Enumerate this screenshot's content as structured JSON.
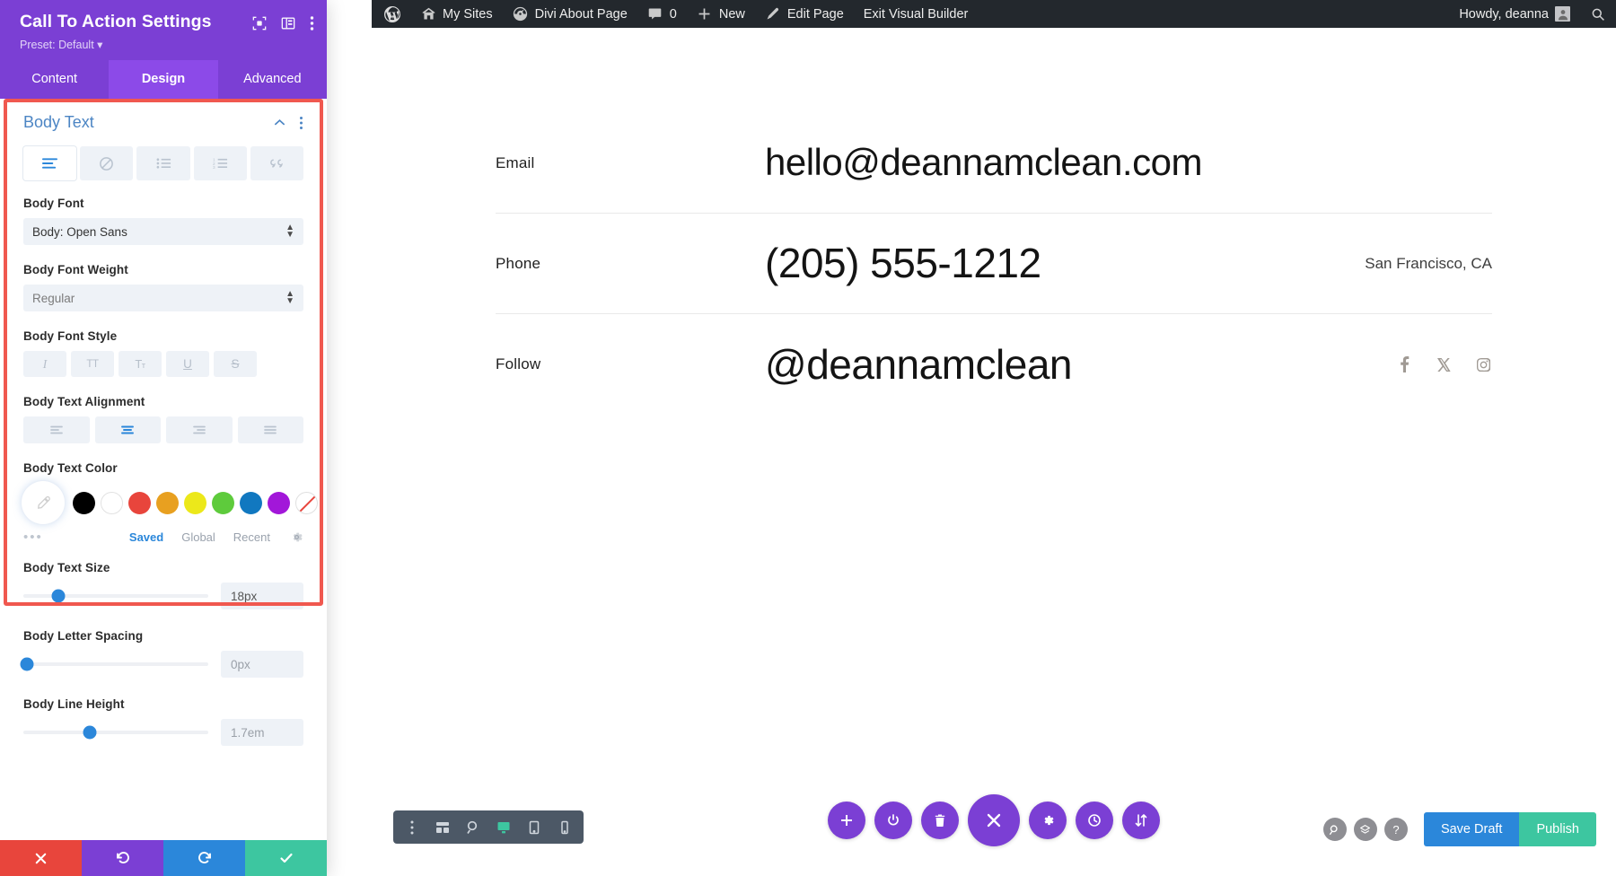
{
  "adminbar": {
    "items": [
      {
        "icon": "wordpress-logo-icon",
        "label": ""
      },
      {
        "icon": "my-sites-icon",
        "label": "My Sites"
      },
      {
        "icon": "dashboard-icon",
        "label": "Divi About Page"
      },
      {
        "icon": "comment-icon",
        "label": "0"
      },
      {
        "icon": "plus-icon",
        "label": "New"
      },
      {
        "icon": "pencil-icon",
        "label": "Edit Page"
      },
      {
        "icon": "",
        "label": "Exit Visual Builder"
      }
    ],
    "howdy": "Howdy, deanna",
    "search_icon": "search-icon"
  },
  "panel": {
    "title": "Call To Action Settings",
    "preset": "Preset: Default",
    "preset_caret": "▾",
    "header_icons": [
      "responsive-preview-icon",
      "layout-columns-icon",
      "more-vertical-icon"
    ],
    "tabs": [
      {
        "label": "Content",
        "active": false
      },
      {
        "label": "Design",
        "active": true
      },
      {
        "label": "Advanced",
        "active": false
      }
    ],
    "section": {
      "title": "Body Text",
      "collapse_icon": "chevron-up-icon",
      "more_icon": "more-vertical-icon",
      "type_tabs": [
        {
          "name": "paragraph-icon",
          "selected": true
        },
        {
          "name": "link-icon",
          "selected": false
        },
        {
          "name": "unordered-list-icon",
          "selected": false
        },
        {
          "name": "ordered-list-icon",
          "selected": false
        },
        {
          "name": "blockquote-icon",
          "selected": false
        }
      ],
      "body_font": {
        "label": "Body Font",
        "value": "Body: Open Sans"
      },
      "body_font_weight": {
        "label": "Body Font Weight",
        "value": "Regular"
      },
      "body_font_style": {
        "label": "Body Font Style",
        "buttons": [
          {
            "name": "italic-icon",
            "glyph": "I"
          },
          {
            "name": "uppercase-icon",
            "glyph": "TT"
          },
          {
            "name": "capitalize-icon",
            "glyph": "Tт"
          },
          {
            "name": "underline-icon",
            "glyph": "U"
          },
          {
            "name": "strikethrough-icon",
            "glyph": "S"
          }
        ]
      },
      "body_text_alignment": {
        "label": "Body Text Alignment",
        "options": [
          {
            "name": "align-left-icon",
            "selected": false
          },
          {
            "name": "align-center-icon",
            "selected": true
          },
          {
            "name": "align-right-icon",
            "selected": false
          },
          {
            "name": "align-justify-icon",
            "selected": false
          }
        ]
      },
      "body_text_color": {
        "label": "Body Text Color",
        "active_swatch": "eyedropper-icon",
        "swatches": [
          "#000000",
          "#ffffff",
          "#e8453c",
          "#e8a020",
          "#ece81a",
          "#5ecb3c",
          "#1178c0",
          "#a217d9"
        ],
        "no_color_swatch": "no-color-icon",
        "more_dots": "•••",
        "tabs": [
          {
            "label": "Saved",
            "active": true
          },
          {
            "label": "Global",
            "active": false
          },
          {
            "label": "Recent",
            "active": false
          }
        ],
        "gear_icon": "gear-icon"
      },
      "body_text_size": {
        "label": "Body Text Size",
        "value": "18px",
        "percent": 19
      },
      "body_letter_spacing": {
        "label": "Body Letter Spacing",
        "value": "0px",
        "percent": 2
      },
      "body_line_height": {
        "label": "Body Line Height",
        "value": "1.7em",
        "percent": 36
      }
    },
    "footer_buttons": [
      {
        "name": "cancel-button",
        "icon": "close-icon",
        "color": "#e8453c"
      },
      {
        "name": "undo-button",
        "icon": "undo-icon",
        "color": "#7b3fd4"
      },
      {
        "name": "redo-button",
        "icon": "redo-icon",
        "color": "#2b87da"
      },
      {
        "name": "save-button",
        "icon": "check-icon",
        "color": "#3dc6a0"
      }
    ]
  },
  "content": {
    "rows": [
      {
        "label": "Email",
        "value": "hello@deannamclean.com",
        "meta": "",
        "socials": []
      },
      {
        "label": "Phone",
        "value": "(205) 555-1212",
        "meta": "San Francisco, CA",
        "socials": []
      },
      {
        "label": "Follow",
        "value": "@deannamclean",
        "meta": "",
        "socials": [
          "facebook-icon",
          "x-twitter-icon",
          "instagram-icon"
        ]
      }
    ]
  },
  "bottombar": {
    "left_tools": [
      {
        "name": "more-vertical-icon",
        "active": false
      },
      {
        "name": "wireframe-view-icon",
        "active": false
      },
      {
        "name": "zoom-out-view-icon",
        "active": false
      },
      {
        "name": "desktop-view-icon",
        "active": true
      },
      {
        "name": "tablet-view-icon",
        "active": false
      },
      {
        "name": "phone-view-icon",
        "active": false
      }
    ],
    "center_tools": [
      {
        "name": "add-section-button",
        "icon": "plus-icon",
        "big": false
      },
      {
        "name": "page-settings-button",
        "icon": "power-icon",
        "big": false
      },
      {
        "name": "delete-button",
        "icon": "trash-icon",
        "big": false
      },
      {
        "name": "close-menu-button",
        "icon": "close-icon",
        "big": true
      },
      {
        "name": "settings-button",
        "icon": "gear-icon",
        "big": false
      },
      {
        "name": "history-button",
        "icon": "clock-icon",
        "big": false
      },
      {
        "name": "portability-button",
        "icon": "up-down-arrows-icon",
        "big": false
      }
    ],
    "right_tools": [
      {
        "name": "search-button",
        "icon": "zoom-search-icon"
      },
      {
        "name": "layers-button",
        "icon": "layers-icon"
      },
      {
        "name": "help-button",
        "icon": "question-mark-icon"
      }
    ],
    "save_draft_label": "Save Draft",
    "publish_label": "Publish"
  },
  "colors": {
    "divi_purple": "#7b3fd4",
    "highlight_red": "#f0584f",
    "accent_blue": "#2b87da",
    "publish_green": "#3dc6a0"
  }
}
